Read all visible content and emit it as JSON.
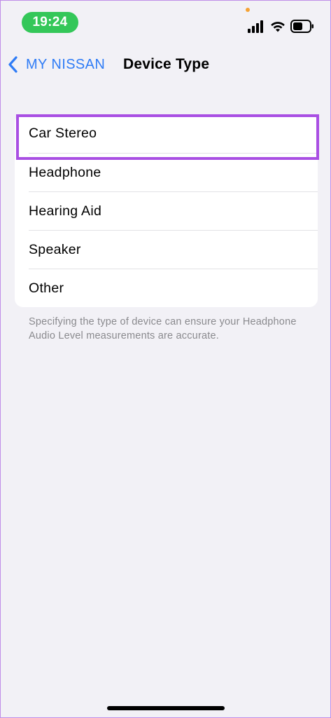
{
  "status_bar": {
    "time": "19:24",
    "time_pill_color": "#34c759",
    "icons": [
      "cellular-signal-icon",
      "wifi-icon",
      "battery-icon"
    ]
  },
  "nav": {
    "back_label": "MY NISSAN",
    "back_icon": "chevron-left-icon",
    "title": "Device Type",
    "accent_color": "#2f7cf6"
  },
  "options": [
    {
      "label": "Car Stereo",
      "highlighted": true
    },
    {
      "label": "Headphone",
      "highlighted": false
    },
    {
      "label": "Hearing Aid",
      "highlighted": false
    },
    {
      "label": "Speaker",
      "highlighted": false
    },
    {
      "label": "Other",
      "highlighted": false
    }
  ],
  "highlight_color": "#a94fe3",
  "footer_note": "Specifying the type of device can ensure your Headphone Audio Level measurements are accurate."
}
